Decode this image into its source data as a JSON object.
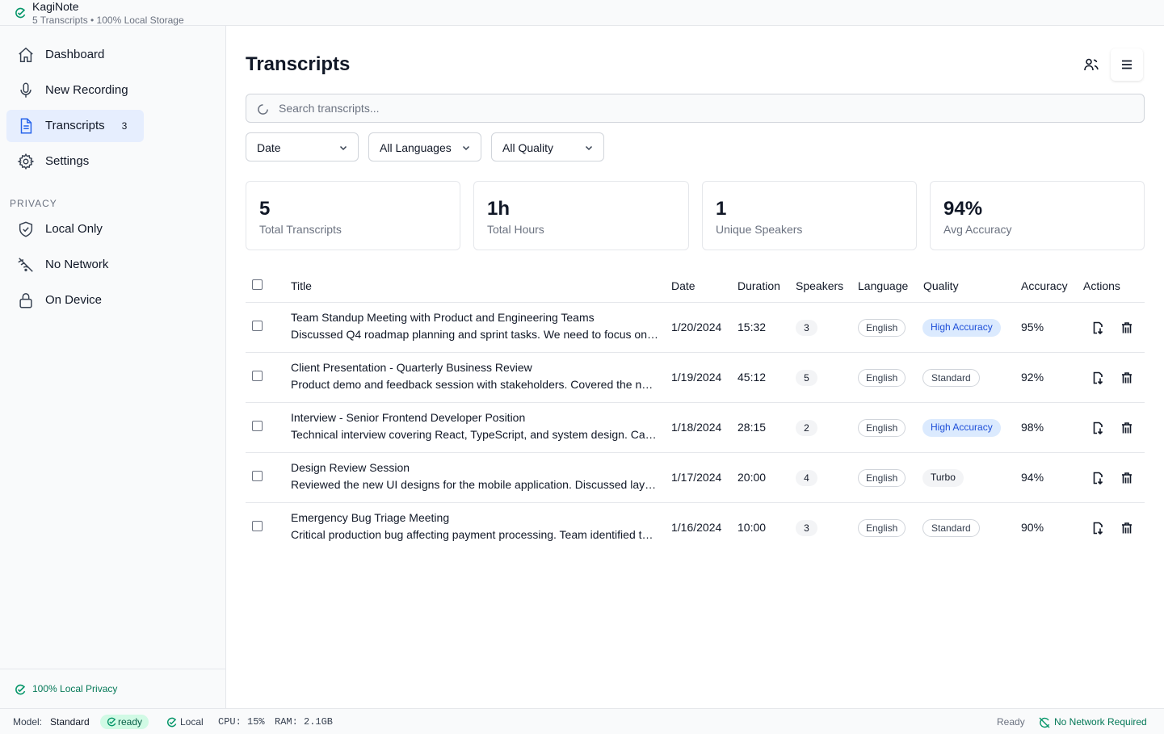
{
  "app": {
    "title": "KagiNote",
    "subtitle": "5 Transcripts • 100% Local Storage"
  },
  "sidebar": {
    "nav": [
      {
        "label": "Dashboard",
        "icon": "home-icon"
      },
      {
        "label": "New Recording",
        "icon": "microphone-icon"
      },
      {
        "label": "Transcripts",
        "icon": "document-icon",
        "count": "3",
        "active": true
      },
      {
        "label": "Settings",
        "icon": "gear-icon"
      }
    ],
    "section_label": "PRIVACY",
    "privacy": [
      {
        "label": "Local Only",
        "icon": "shield-check-icon"
      },
      {
        "label": "No Network",
        "icon": "no-network-icon"
      },
      {
        "label": "On Device",
        "icon": "lock-icon"
      }
    ],
    "footer": "100% Local Privacy"
  },
  "main": {
    "title": "Transcripts",
    "search_placeholder": "Search transcripts...",
    "filters": {
      "sort": "Date",
      "language": "All Languages",
      "quality": "All Quality"
    },
    "stats": [
      {
        "value": "5",
        "label": "Total Transcripts"
      },
      {
        "value": "1h",
        "label": "Total Hours"
      },
      {
        "value": "1",
        "label": "Unique Speakers"
      },
      {
        "value": "94%",
        "label": "Avg Accuracy"
      }
    ],
    "columns": [
      "Title",
      "Date",
      "Duration",
      "Speakers",
      "Language",
      "Quality",
      "Accuracy",
      "Actions"
    ],
    "rows": [
      {
        "title": "Team Standup Meeting with Product and Engineering Teams",
        "desc": "Discussed Q4 roadmap planning and sprint tasks. We need to focus on the key deliverables.",
        "date": "1/20/2024",
        "duration": "15:32",
        "speakers": "3",
        "language": "English",
        "quality": "High Accuracy",
        "accuracy": "95%"
      },
      {
        "title": "Client Presentation - Quarterly Business Review",
        "desc": "Product demo and feedback session with stakeholders. Covered the new features and roadmap.",
        "date": "1/19/2024",
        "duration": "45:12",
        "speakers": "5",
        "language": "English",
        "quality": "Standard",
        "accuracy": "92%"
      },
      {
        "title": "Interview - Senior Frontend Developer Position",
        "desc": "Technical interview covering React, TypeScript, and system design. Candidate showed strong skills.",
        "date": "1/18/2024",
        "duration": "28:15",
        "speakers": "2",
        "language": "English",
        "quality": "High Accuracy",
        "accuracy": "98%"
      },
      {
        "title": "Design Review Session",
        "desc": "Reviewed the new UI designs for the mobile application. Discussed layout and color choices.",
        "date": "1/17/2024",
        "duration": "20:00",
        "speakers": "4",
        "language": "English",
        "quality": "Turbo",
        "accuracy": "94%"
      },
      {
        "title": "Emergency Bug Triage Meeting",
        "desc": "Critical production bug affecting payment processing. Team identified the root cause quickly.",
        "date": "1/16/2024",
        "duration": "10:00",
        "speakers": "3",
        "language": "English",
        "quality": "Standard",
        "accuracy": "90%"
      }
    ]
  },
  "statusbar": {
    "model_label": "Model:",
    "model_value": "Standard",
    "ready": "ready",
    "local": "Local",
    "cpu": "CPU: 15%",
    "ram": "RAM: 2.1GB",
    "state": "Ready",
    "network": "No Network Required"
  },
  "colors": {
    "accent": "#2563eb",
    "active_bg": "#e6eefe",
    "privacy_green": "#047857",
    "high_badge_bg": "#dbeafe",
    "high_badge_text": "#1d4ed8"
  }
}
